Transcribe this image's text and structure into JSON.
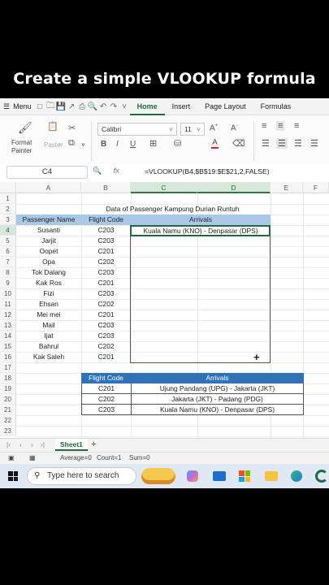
{
  "caption": "Create a simple VLOOKUP formula",
  "menubar": {
    "menu_label": "Menu",
    "tabs": [
      "Home",
      "Insert",
      "Page Layout",
      "Formulas"
    ],
    "active_tab": "Home"
  },
  "ribbon": {
    "format_painter": "Format Painter",
    "paste": "Paste",
    "font_name": "Calibri",
    "font_size": "11",
    "font_color_accent": "#e0261b"
  },
  "formula_bar": {
    "name_box": "C4",
    "fx_label": "fx",
    "formula": "=VLOOKUP(B4,$B$19:$E$21,2,FALSE)"
  },
  "columns": [
    "A",
    "B",
    "C",
    "D",
    "E",
    "F"
  ],
  "rows": [
    "1",
    "2",
    "3",
    "4",
    "5",
    "6",
    "7",
    "8",
    "9",
    "10",
    "11",
    "12",
    "13",
    "14",
    "15",
    "16",
    "17",
    "18",
    "19",
    "20",
    "21",
    "22",
    "23"
  ],
  "sheet": {
    "title": "Data of Passenger Kampung Durian Runtuh",
    "headers": {
      "passenger_name": "Passenger Name",
      "flight_code": "Flight Code",
      "arrivals": "Arrivals"
    },
    "active_value": "Kuala Namu (KNO) - Denpasar (DPS)",
    "passengers": [
      {
        "name": "Susanti",
        "code": "C203"
      },
      {
        "name": "Jarjit",
        "code": "C203"
      },
      {
        "name": "Oopet",
        "code": "C201"
      },
      {
        "name": "Opa",
        "code": "C202"
      },
      {
        "name": "Tok Dalang",
        "code": "C203"
      },
      {
        "name": "Kak Ros",
        "code": "C201"
      },
      {
        "name": "Fizi",
        "code": "C203"
      },
      {
        "name": "Ehsan",
        "code": "C202"
      },
      {
        "name": "Mei mei",
        "code": "C201"
      },
      {
        "name": "Mail",
        "code": "C203"
      },
      {
        "name": "Ijat",
        "code": "C203"
      },
      {
        "name": "Bahrul",
        "code": "C202"
      },
      {
        "name": "Kak Saleh",
        "code": "C201"
      }
    ],
    "lookup_headers": {
      "flight_code": "Flight Code",
      "arrivals": "Arrivals"
    },
    "lookup": [
      {
        "code": "C201",
        "route": "Ujung Pandang (UPG) - Jakarta (JKT)"
      },
      {
        "code": "C202",
        "route": "Jakarta (JKT) - Padang (PDG)"
      },
      {
        "code": "C203",
        "route": "Kuala Namu (KNO) - Denpasar (DPS)"
      }
    ]
  },
  "sheet_tabs": {
    "active": "Sheet1",
    "add": "+"
  },
  "status": {
    "average": "Average=0",
    "count": "Count=1",
    "sum": "Sum=0"
  },
  "taskbar": {
    "search_placeholder": "Type here to search"
  },
  "colors": {
    "excel_green": "#1f6b3d",
    "header_light_blue": "#a9c8e6",
    "header_dark_blue": "#2f72b8"
  }
}
